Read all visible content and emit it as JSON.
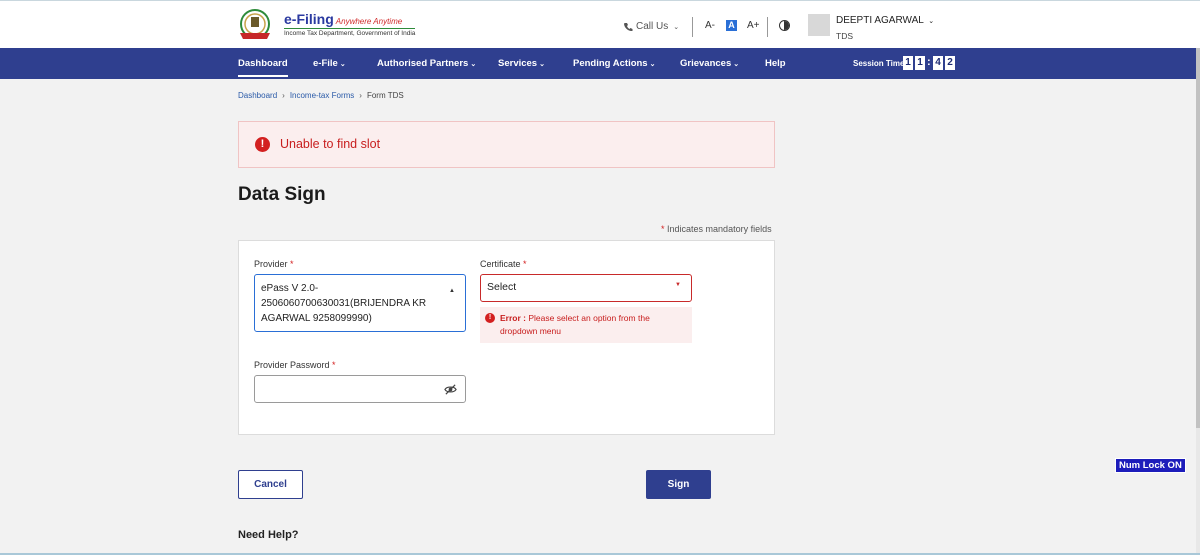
{
  "header": {
    "logo_title": "e-Filing",
    "logo_tagline": "Anywhere Anytime",
    "logo_subtitle": "Income Tax Department, Government of India",
    "call_us": "Call Us",
    "font_decrease": "A-",
    "font_normal": "A",
    "font_increase": "A+",
    "user_name": "DEEPTI AGARWAL",
    "user_role": "TDS"
  },
  "nav": {
    "items": [
      {
        "label": "Dashboard"
      },
      {
        "label": "e-File"
      },
      {
        "label": "Authorised Partners"
      },
      {
        "label": "Services"
      },
      {
        "label": "Pending Actions"
      },
      {
        "label": "Grievances"
      },
      {
        "label": "Help"
      }
    ],
    "session_label": "Session Time",
    "session_digits": [
      "1",
      "1",
      "4",
      "2"
    ]
  },
  "breadcrumb": {
    "items": [
      "Dashboard",
      "Income-tax Forms",
      "Form TDS"
    ]
  },
  "alert": {
    "message": "Unable to find slot"
  },
  "page": {
    "title": "Data Sign",
    "mandatory_note": "Indicates mandatory fields"
  },
  "form": {
    "provider_label": "Provider",
    "provider_value": "ePass V 2.0-2506060700630031(BRIJENDRA KR AGARWAL  9258099990)",
    "certificate_label": "Certificate",
    "certificate_value": "Select",
    "certificate_error_prefix": "Error :",
    "certificate_error": "Please select an option from the dropdown menu",
    "password_label": "Provider Password",
    "password_value": ""
  },
  "actions": {
    "cancel": "Cancel",
    "sign": "Sign"
  },
  "footer": {
    "need_help": "Need Help?"
  },
  "overlay": {
    "numlock": "Num Lock ON"
  },
  "colors": {
    "nav_bg": "#2f3f8f",
    "error": "#c81e1e",
    "focus": "#2a6fd6"
  }
}
